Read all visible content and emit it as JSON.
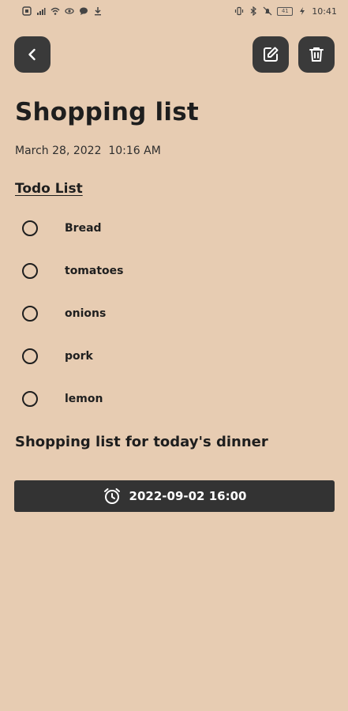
{
  "status_bar": {
    "time": "10:41",
    "battery_label": "41"
  },
  "note": {
    "title": "Shopping list",
    "date": "March 28, 2022  10:16 AM",
    "section_heading": "Todo List",
    "todos": [
      {
        "label": "Bread",
        "checked": false
      },
      {
        "label": "tomatoes",
        "checked": false
      },
      {
        "label": "onions",
        "checked": false
      },
      {
        "label": "pork",
        "checked": false
      },
      {
        "label": "lemon",
        "checked": false
      }
    ],
    "description": "Shopping list for today's dinner",
    "reminder": "2022-09-02 16:00"
  },
  "icons": {
    "back": "chevron-left-icon",
    "edit": "edit-icon",
    "delete": "trash-icon",
    "reminder": "alarm-clock-icon"
  },
  "colors": {
    "background": "#e7ccb2",
    "button_bg": "#3a3a3a",
    "reminder_bg": "#333333",
    "text": "#1f1f1f"
  }
}
